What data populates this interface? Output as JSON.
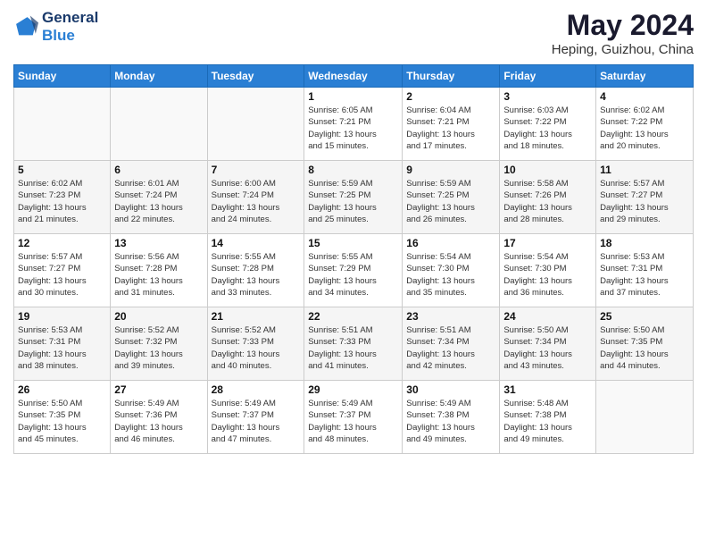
{
  "header": {
    "logo_line1": "General",
    "logo_line2": "Blue",
    "month": "May 2024",
    "location": "Heping, Guizhou, China"
  },
  "days_of_week": [
    "Sunday",
    "Monday",
    "Tuesday",
    "Wednesday",
    "Thursday",
    "Friday",
    "Saturday"
  ],
  "weeks": [
    [
      {
        "day": "",
        "info": ""
      },
      {
        "day": "",
        "info": ""
      },
      {
        "day": "",
        "info": ""
      },
      {
        "day": "1",
        "info": "Sunrise: 6:05 AM\nSunset: 7:21 PM\nDaylight: 13 hours\nand 15 minutes."
      },
      {
        "day": "2",
        "info": "Sunrise: 6:04 AM\nSunset: 7:21 PM\nDaylight: 13 hours\nand 17 minutes."
      },
      {
        "day": "3",
        "info": "Sunrise: 6:03 AM\nSunset: 7:22 PM\nDaylight: 13 hours\nand 18 minutes."
      },
      {
        "day": "4",
        "info": "Sunrise: 6:02 AM\nSunset: 7:22 PM\nDaylight: 13 hours\nand 20 minutes."
      }
    ],
    [
      {
        "day": "5",
        "info": "Sunrise: 6:02 AM\nSunset: 7:23 PM\nDaylight: 13 hours\nand 21 minutes."
      },
      {
        "day": "6",
        "info": "Sunrise: 6:01 AM\nSunset: 7:24 PM\nDaylight: 13 hours\nand 22 minutes."
      },
      {
        "day": "7",
        "info": "Sunrise: 6:00 AM\nSunset: 7:24 PM\nDaylight: 13 hours\nand 24 minutes."
      },
      {
        "day": "8",
        "info": "Sunrise: 5:59 AM\nSunset: 7:25 PM\nDaylight: 13 hours\nand 25 minutes."
      },
      {
        "day": "9",
        "info": "Sunrise: 5:59 AM\nSunset: 7:25 PM\nDaylight: 13 hours\nand 26 minutes."
      },
      {
        "day": "10",
        "info": "Sunrise: 5:58 AM\nSunset: 7:26 PM\nDaylight: 13 hours\nand 28 minutes."
      },
      {
        "day": "11",
        "info": "Sunrise: 5:57 AM\nSunset: 7:27 PM\nDaylight: 13 hours\nand 29 minutes."
      }
    ],
    [
      {
        "day": "12",
        "info": "Sunrise: 5:57 AM\nSunset: 7:27 PM\nDaylight: 13 hours\nand 30 minutes."
      },
      {
        "day": "13",
        "info": "Sunrise: 5:56 AM\nSunset: 7:28 PM\nDaylight: 13 hours\nand 31 minutes."
      },
      {
        "day": "14",
        "info": "Sunrise: 5:55 AM\nSunset: 7:28 PM\nDaylight: 13 hours\nand 33 minutes."
      },
      {
        "day": "15",
        "info": "Sunrise: 5:55 AM\nSunset: 7:29 PM\nDaylight: 13 hours\nand 34 minutes."
      },
      {
        "day": "16",
        "info": "Sunrise: 5:54 AM\nSunset: 7:30 PM\nDaylight: 13 hours\nand 35 minutes."
      },
      {
        "day": "17",
        "info": "Sunrise: 5:54 AM\nSunset: 7:30 PM\nDaylight: 13 hours\nand 36 minutes."
      },
      {
        "day": "18",
        "info": "Sunrise: 5:53 AM\nSunset: 7:31 PM\nDaylight: 13 hours\nand 37 minutes."
      }
    ],
    [
      {
        "day": "19",
        "info": "Sunrise: 5:53 AM\nSunset: 7:31 PM\nDaylight: 13 hours\nand 38 minutes."
      },
      {
        "day": "20",
        "info": "Sunrise: 5:52 AM\nSunset: 7:32 PM\nDaylight: 13 hours\nand 39 minutes."
      },
      {
        "day": "21",
        "info": "Sunrise: 5:52 AM\nSunset: 7:33 PM\nDaylight: 13 hours\nand 40 minutes."
      },
      {
        "day": "22",
        "info": "Sunrise: 5:51 AM\nSunset: 7:33 PM\nDaylight: 13 hours\nand 41 minutes."
      },
      {
        "day": "23",
        "info": "Sunrise: 5:51 AM\nSunset: 7:34 PM\nDaylight: 13 hours\nand 42 minutes."
      },
      {
        "day": "24",
        "info": "Sunrise: 5:50 AM\nSunset: 7:34 PM\nDaylight: 13 hours\nand 43 minutes."
      },
      {
        "day": "25",
        "info": "Sunrise: 5:50 AM\nSunset: 7:35 PM\nDaylight: 13 hours\nand 44 minutes."
      }
    ],
    [
      {
        "day": "26",
        "info": "Sunrise: 5:50 AM\nSunset: 7:35 PM\nDaylight: 13 hours\nand 45 minutes."
      },
      {
        "day": "27",
        "info": "Sunrise: 5:49 AM\nSunset: 7:36 PM\nDaylight: 13 hours\nand 46 minutes."
      },
      {
        "day": "28",
        "info": "Sunrise: 5:49 AM\nSunset: 7:37 PM\nDaylight: 13 hours\nand 47 minutes."
      },
      {
        "day": "29",
        "info": "Sunrise: 5:49 AM\nSunset: 7:37 PM\nDaylight: 13 hours\nand 48 minutes."
      },
      {
        "day": "30",
        "info": "Sunrise: 5:49 AM\nSunset: 7:38 PM\nDaylight: 13 hours\nand 49 minutes."
      },
      {
        "day": "31",
        "info": "Sunrise: 5:48 AM\nSunset: 7:38 PM\nDaylight: 13 hours\nand 49 minutes."
      },
      {
        "day": "",
        "info": ""
      }
    ]
  ]
}
